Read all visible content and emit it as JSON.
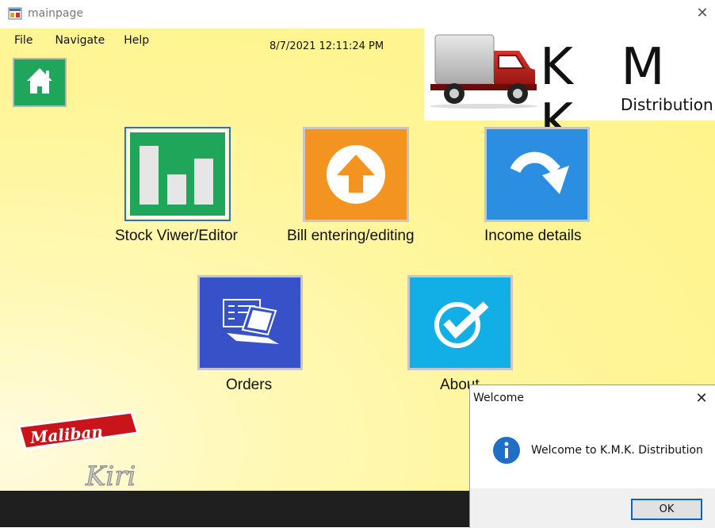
{
  "window": {
    "title": "mainpage",
    "close_glyph": "✕"
  },
  "menu": {
    "file": "File",
    "navigate": "Navigate",
    "help": "Help"
  },
  "datetime": "8/7/2021 12:11:24 PM",
  "logo": {
    "brand": "K M K",
    "tagline": "Distribution"
  },
  "tiles": [
    {
      "label": "Stock Viwer/Editor",
      "color": "#1fa65a",
      "icon": "bar-chart-icon"
    },
    {
      "label": "Bill entering/editing",
      "color": "#f39421",
      "icon": "upload-arrow-icon"
    },
    {
      "label": "Income details",
      "color": "#2b8ee0",
      "icon": "curved-arrow-down-icon"
    },
    {
      "label": "Orders",
      "color": "#3751c9",
      "icon": "laptop-document-icon"
    },
    {
      "label": "About",
      "color": "#12aee6",
      "icon": "check-circle-icon"
    }
  ],
  "branding": {
    "top": "Maliban",
    "bottom": "Kiri"
  },
  "dialog": {
    "title": "Welcome",
    "close_glyph": "✕",
    "message": "Welcome to K.M.K. Distribution",
    "ok_label": "OK"
  },
  "colors": {
    "home_button": "#1fa65a",
    "truck_red": "#b8201c",
    "dialog_accent": "#0a64c8"
  }
}
